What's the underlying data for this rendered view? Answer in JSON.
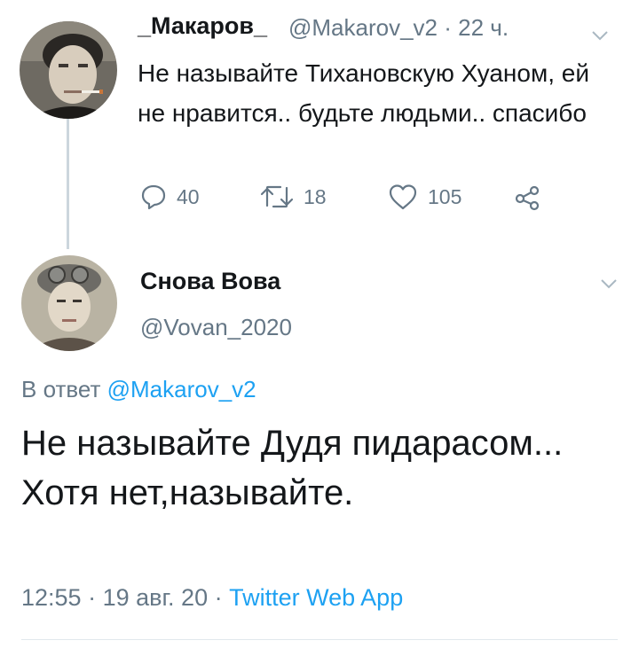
{
  "tweet1": {
    "name": "_Макаров_",
    "handle": "@Makarov_v2",
    "separator": "·",
    "time": "22 ч.",
    "text": "Не называйте Тихановскую Хуаном, ей не нравится.. будьте людьми.. спасибо",
    "actions": {
      "replies": "40",
      "retweets": "18",
      "likes": "105"
    }
  },
  "tweet2": {
    "name": "Снова Вова",
    "handle": "@Vovan_2020",
    "reply_prefix": "В ответ",
    "reply_to": "@Makarov_v2",
    "text": "Не называйте Дудя пидарасом... Хотя нет,называйте.",
    "time": "12:55",
    "separator": "·",
    "date": "19 авг. 20",
    "source": "Twitter Web App"
  },
  "colors": {
    "text": "#14171a",
    "secondary": "#657786",
    "link": "#1da1f2",
    "thread_line": "#ccd6dd",
    "divider": "#e1e8ed"
  },
  "icons": {
    "reply": "reply-icon",
    "retweet": "retweet-icon",
    "like": "heart-icon",
    "share": "share-icon",
    "menu": "chevron-down-icon"
  }
}
